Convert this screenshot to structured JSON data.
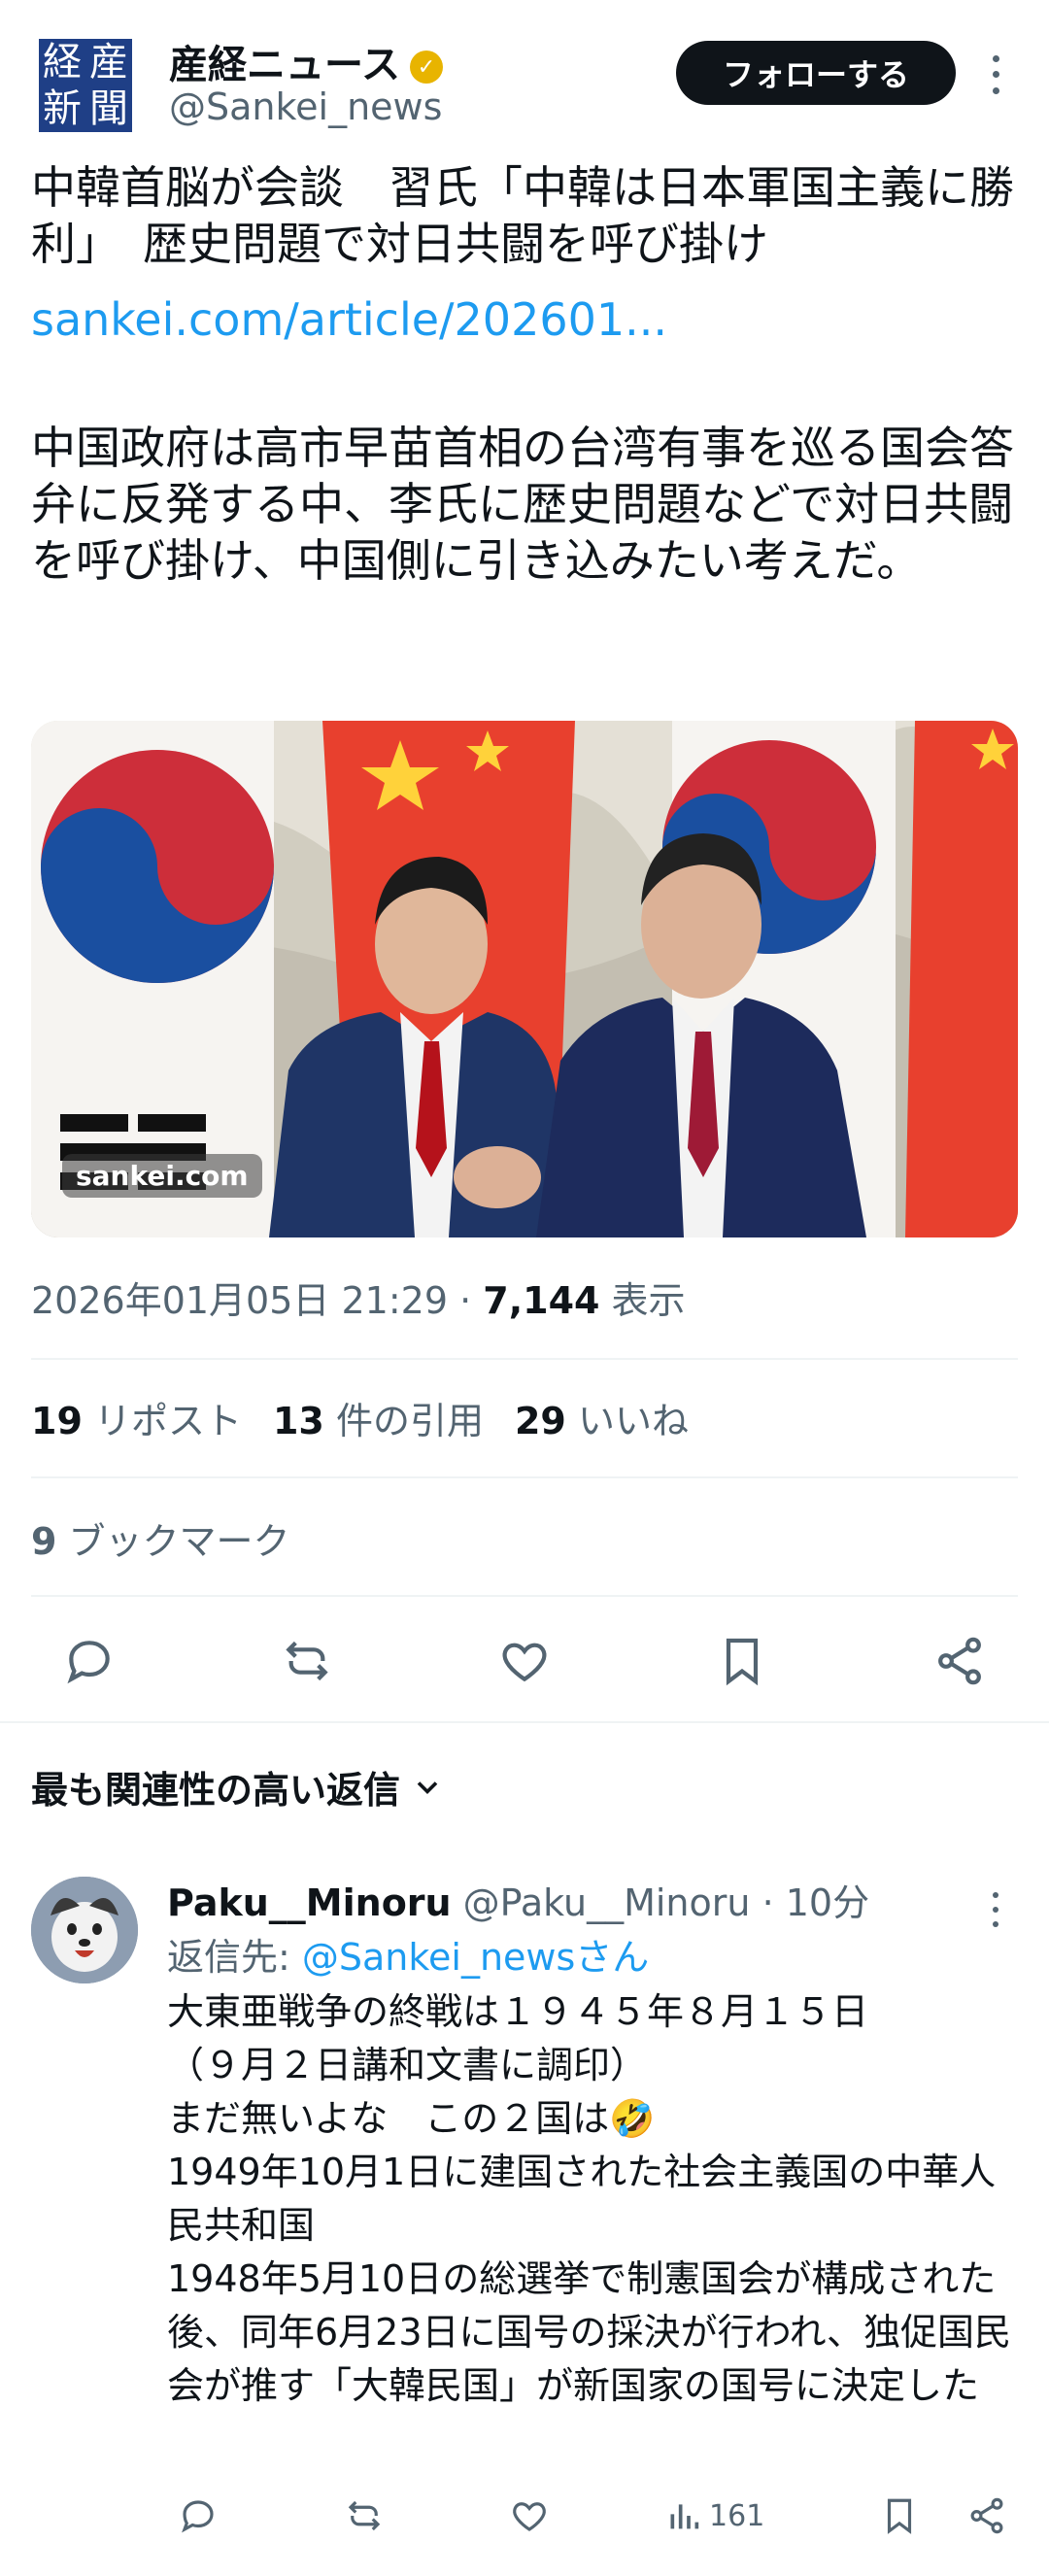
{
  "tweet": {
    "author": {
      "logo_chars": [
        "産",
        "経",
        "新",
        "聞"
      ],
      "name": "産経ニュース",
      "handle": "@Sankei_news",
      "verified_icon": "verified-badge-icon",
      "verified_color": "#e8b400"
    },
    "follow_label": "フォローする",
    "headline": "中韓首脳が会談　習氏「中韓は日本軍国主義に勝利」　歴史問題で対日共闘を呼び掛け",
    "link": "sankei.com/article/202601...",
    "paragraph": "中国政府は高市早苗首相の台湾有事を巡る国会答弁に反発する中、李氏に歴史問題などで対日共闘を呼び掛け、中国側に引き込みたい考えだ。",
    "image_watermark": "sankei.com",
    "timestamp": "2026年01月05日 21:29",
    "dot": " · ",
    "views_count": "7,144",
    "views_label": " 表示",
    "stats": [
      {
        "count": "19",
        "label": " リポスト"
      },
      {
        "count": "13",
        "label": " 件の引用"
      },
      {
        "count": "29",
        "label": " いいね"
      }
    ],
    "bookmarks": {
      "count": "9",
      "label": " ブックマーク"
    },
    "actions": [
      "reply-icon",
      "retweet-icon",
      "like-icon",
      "bookmark-icon",
      "share-icon"
    ]
  },
  "replies_header": "最も関連性の高い返信",
  "reply": {
    "name": "Paku__Minoru",
    "handle": " @Paku__Minoru",
    "time": " · 10分",
    "reply_to_label": "返信先: ",
    "reply_to_handle": "@Sankei_newsさん",
    "lines": [
      "大東亜戦争の終戦は１９４５年８月１５日",
      "（９月２日講和文書に調印）",
      "まだ無いよな　この２国は🤣",
      "1949年10月1日に建国された社会主義国の中華人民共和国",
      "1948年5月10日の総選挙で制憲国会が構成された後、同年6月23日に国号の採決が行われ、独促国民会が推す「大韓民国」が新国家の国号に決定した"
    ],
    "views": "161"
  },
  "colors": {
    "text": "#0f1419",
    "muted": "#536471",
    "link": "#1d9bf0",
    "logo_blue": "#1f3f86"
  }
}
